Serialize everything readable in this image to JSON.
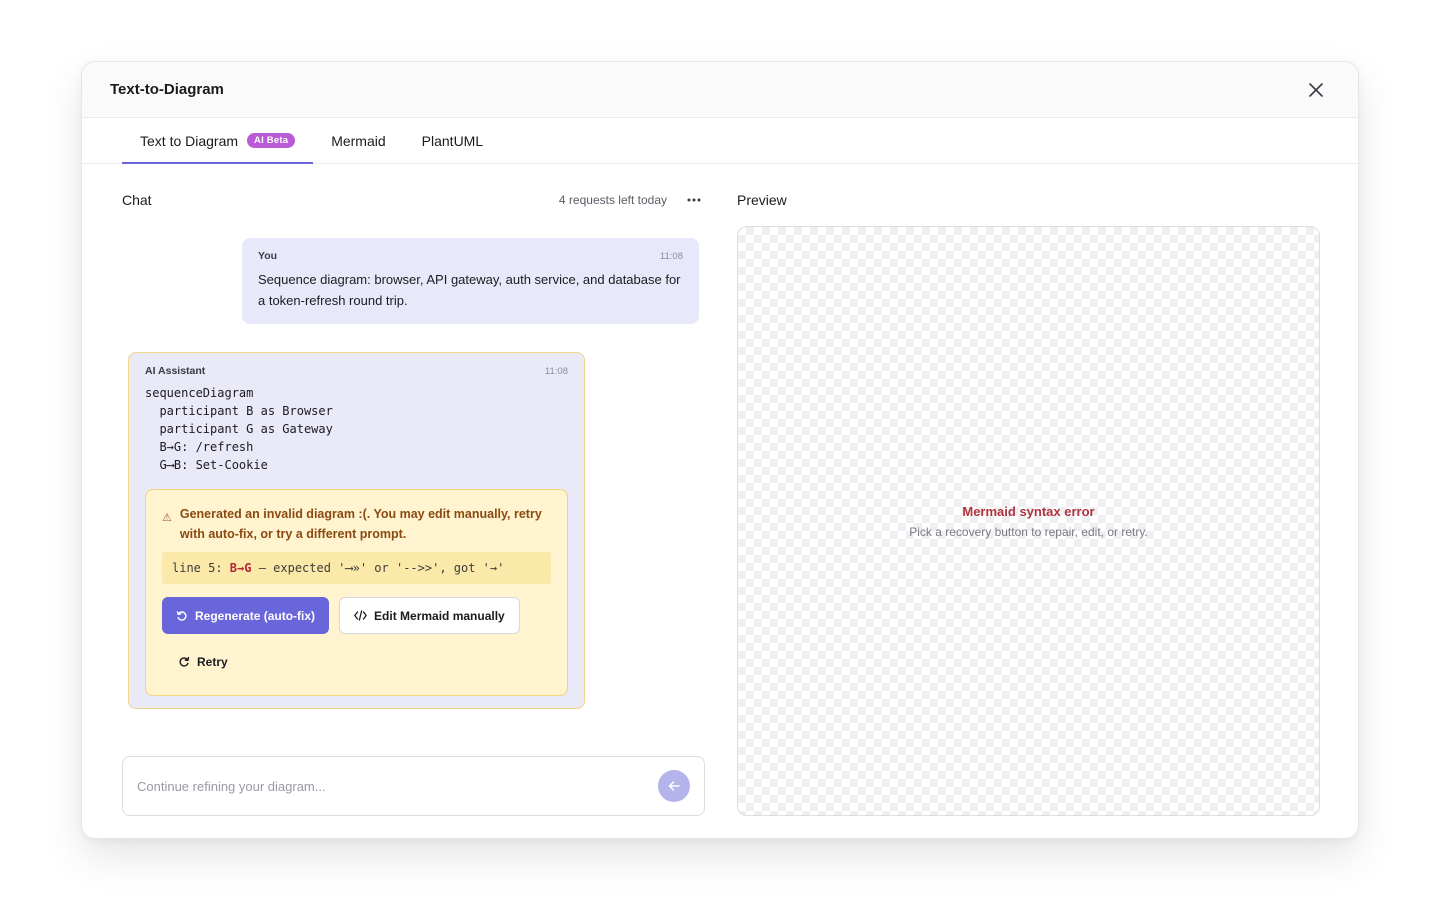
{
  "dialog": {
    "title": "Text-to-Diagram"
  },
  "tabs": [
    {
      "label": "Text to Diagram",
      "badge": "AI Beta",
      "active": true
    },
    {
      "label": "Mermaid",
      "active": false
    },
    {
      "label": "PlantUML",
      "active": false
    }
  ],
  "chat": {
    "title": "Chat",
    "requests_left": "4 requests left today",
    "user_message": {
      "author": "You",
      "time": "11:08",
      "text": "Sequence diagram: browser, API gateway, auth service, and database for a token-refresh round trip."
    },
    "ai_message": {
      "author": "AI Assistant",
      "time": "11:08",
      "code": "sequenceDiagram\n  participant B as Browser\n  participant G as Gateway\n  B→G: /refresh\n  G⟶B: Set-Cookie"
    },
    "error": {
      "message": "Generated an invalid diagram :(. You may edit manually, retry with auto-fix, or try a different prompt.",
      "line_prefix": "line 5: ",
      "line_highlight": "B→G",
      "line_suffix": " — expected '⟶»' or '-->>', got '→'",
      "regenerate_label": "Regenerate (auto-fix)",
      "edit_label": "Edit Mermaid manually",
      "retry_label": "Retry"
    },
    "composer_placeholder": "Continue refining your diagram..."
  },
  "preview": {
    "title": "Preview",
    "error_title": "Mermaid syntax error",
    "error_subtitle": "Pick a recovery button to repair, edit, or retry."
  },
  "colors": {
    "accent": "#6965db",
    "badge": "#b95ad6",
    "error_text": "#8a4a12",
    "error_bg": "#fff4cf",
    "preview_error": "#b0343f"
  },
  "icons": [
    "close-icon",
    "more-dots-icon",
    "warning-icon",
    "refresh-icon",
    "code-icon",
    "retry-icon",
    "send-arrow-icon"
  ]
}
